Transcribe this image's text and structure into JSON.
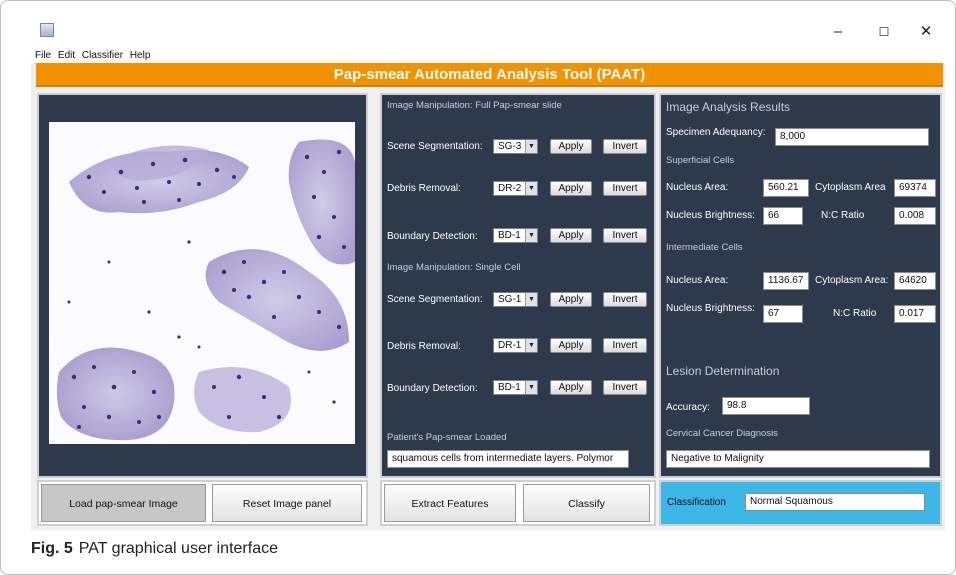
{
  "window": {
    "minimize_glyph": "–",
    "maximize_glyph": "☐",
    "close_glyph": "✕"
  },
  "menu": [
    "File",
    "Edit",
    "Classifier",
    "Help"
  ],
  "app_title": "Pap-smear Automated Analysis Tool (PAAT)",
  "image_panel": {
    "content": "Pap-smear slide microscopy image"
  },
  "full_slide": {
    "section_label": "Image Manipulation: Full Pap-smear slide",
    "rows": [
      {
        "label": "Scene Segmentation:",
        "value": "SG-3",
        "apply": "Apply",
        "invert": "Invert"
      },
      {
        "label": "Debris Removal:",
        "value": "DR-2",
        "apply": "Apply",
        "invert": "Invert"
      },
      {
        "label": "Boundary Detection:",
        "value": "BD-1",
        "apply": "Apply",
        "invert": "Invert"
      }
    ]
  },
  "single_cell": {
    "section_label": "Image Manipulation: Single Cell",
    "rows": [
      {
        "label": "Scene Segmentation:",
        "value": "SG-1",
        "apply": "Apply",
        "invert": "Invert"
      },
      {
        "label": "Debris Removal:",
        "value": "DR-1",
        "apply": "Apply",
        "invert": "Invert"
      },
      {
        "label": "Boundary Detection:",
        "value": "BD-1",
        "apply": "Apply",
        "invert": "Invert"
      }
    ]
  },
  "loaded": {
    "label": "Patient's Pap-smear Loaded",
    "value": "squamous cells from intermediate layers. Polymor"
  },
  "results": {
    "title": "Image Analysis Results",
    "specimen_label": "Specimen Adequancy:",
    "specimen_value": "8,000",
    "superficial": {
      "title": "Superficial Cells",
      "nucleus_area_label": "Nucleus Area:",
      "nucleus_area": "560.21",
      "cytoplasm_area_label": "Cytoplasm Area",
      "cytoplasm_area": "69374",
      "nucleus_brightness_label": "Nucleus Brightness:",
      "nucleus_brightness": "66",
      "nc_ratio_label": "N:C Ratio",
      "nc_ratio": "0.008"
    },
    "intermediate": {
      "title": "Intermediate Cells",
      "nucleus_area_label": "Nucleus Area:",
      "nucleus_area": "1136.67",
      "cytoplasm_area_label": "Cytoplasm Area:",
      "cytoplasm_area": "64620",
      "nucleus_brightness_label": "Nucleus Brightness:",
      "nucleus_brightness": "67",
      "nc_ratio_label": "N:C Ratio",
      "nc_ratio": "0.017"
    },
    "lesion_title": "Lesion Determination",
    "accuracy_label": "Accuracy:",
    "accuracy_value": "98.8",
    "diagnosis_label": "Cervical Cancer Diagnosis",
    "diagnosis_value": "Negative to Malignity"
  },
  "bottom": {
    "load_button": "Load pap-smear Image",
    "reset_button": "Reset Image panel",
    "extract_button": "Extract Features",
    "classify_button": "Classify",
    "classification_label": "Classification",
    "classification_value": "Normal Squamous"
  },
  "caption": {
    "fig": "Fig. 5",
    "text": "PAT graphical user interface"
  },
  "colors": {
    "banner": "#f39200",
    "panel_bg": "#2c3a4c",
    "classification_bg": "#3bb7e8"
  }
}
